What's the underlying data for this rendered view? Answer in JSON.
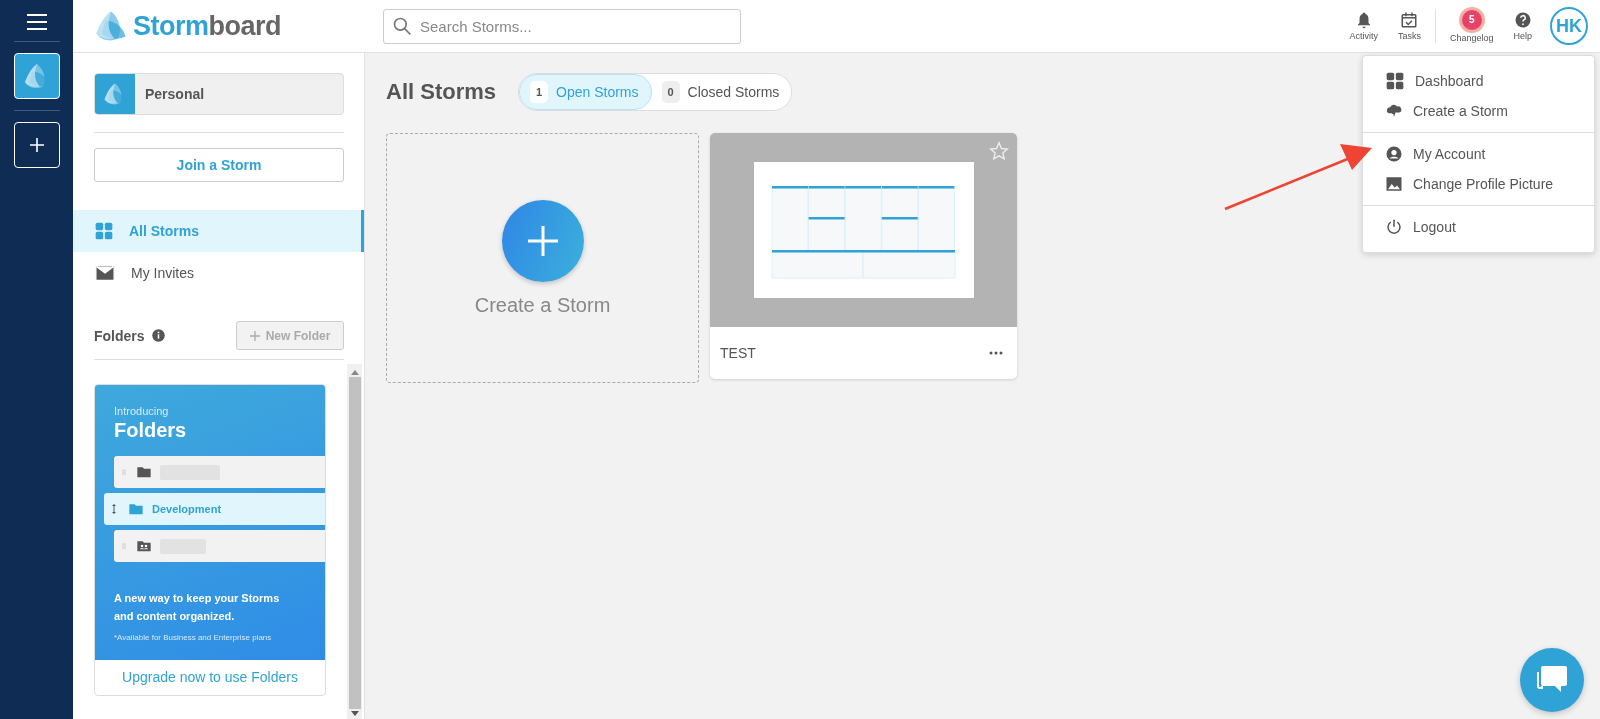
{
  "rail": {
    "workspace_selected": true
  },
  "header": {
    "logo": {
      "accent": "Storm",
      "rest": "board"
    },
    "search": {
      "placeholder": "Search Storms..."
    },
    "actions": [
      {
        "kind": "bell",
        "label": "Activity"
      },
      {
        "kind": "calendar",
        "label": "Tasks"
      },
      {
        "kind": "badge",
        "label": "Changelog",
        "badge": "5"
      },
      {
        "kind": "help",
        "label": "Help"
      }
    ],
    "avatar": "HK"
  },
  "sidebar": {
    "workspace": "Personal",
    "join_button": "Join a Storm",
    "nav": [
      {
        "kind": "grid",
        "label": "All Storms",
        "selected": true
      },
      {
        "kind": "mail",
        "label": "My Invites",
        "selected": false
      }
    ],
    "folders_title": "Folders",
    "new_folder": {
      "label": "New Folder",
      "disabled": true
    },
    "promo": {
      "eyebrow": "Introducing",
      "title": "Folders",
      "rows": [
        {
          "kind": "folder"
        },
        {
          "kind": "dragging",
          "label": "Development"
        },
        {
          "kind": "shared"
        }
      ],
      "text": "A new way to keep your Storms and content organized.",
      "footnote": "*Available for Business and Enterprise plans",
      "link": "Upgrade now to use Folders"
    }
  },
  "main": {
    "title": "All Storms",
    "filters": [
      {
        "count": "1",
        "label": "Open Storms",
        "selected": true
      },
      {
        "count": "0",
        "label": "Closed Storms",
        "selected": false
      }
    ],
    "create_card": "Create a Storm",
    "storms": [
      {
        "title": "TEST",
        "starred": false
      }
    ]
  },
  "menu": {
    "groups": [
      [
        {
          "kind": "grid",
          "label": "Dashboard"
        },
        {
          "kind": "storm",
          "label": "Create a Storm"
        }
      ],
      [
        {
          "kind": "user",
          "label": "My Account"
        },
        {
          "kind": "image",
          "label": "Change Profile Picture"
        }
      ],
      [
        {
          "kind": "power",
          "label": "Logout"
        }
      ]
    ]
  }
}
